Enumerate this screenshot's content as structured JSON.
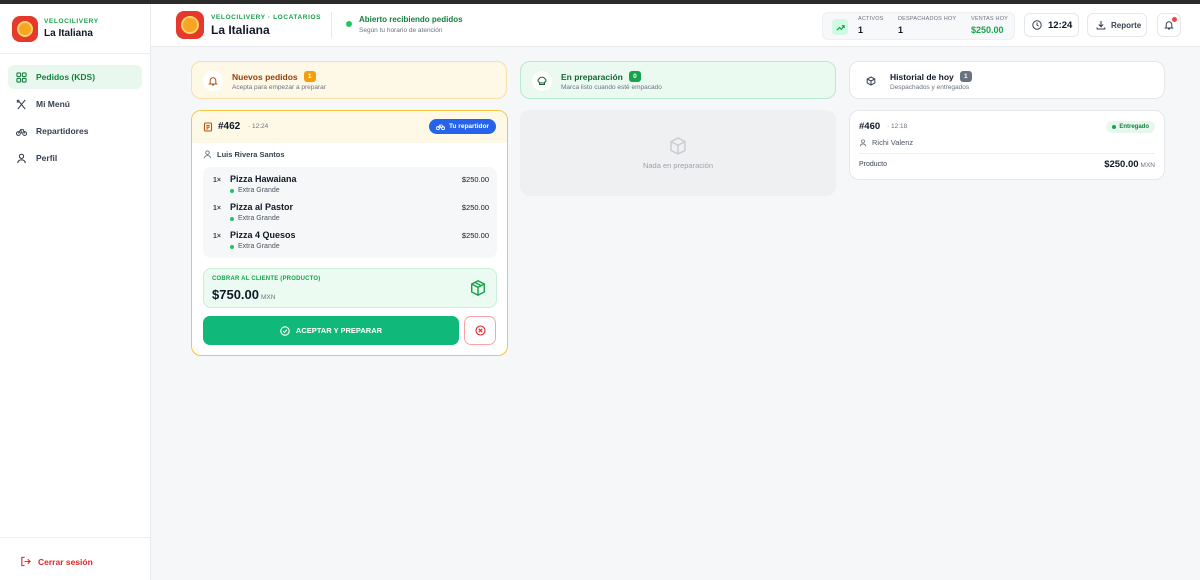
{
  "brand": {
    "kicker": "VELOCILIVERY",
    "name": "La Italiana"
  },
  "nav": {
    "items": [
      {
        "label": "Pedidos (KDS)",
        "icon": "grid-icon",
        "active": true
      },
      {
        "label": "Mi Menú",
        "icon": "utensils-icon",
        "active": false
      },
      {
        "label": "Repartidores",
        "icon": "bike-icon",
        "active": false
      },
      {
        "label": "Perfil",
        "icon": "user-icon",
        "active": false
      }
    ],
    "logout": "Cerrar sesión"
  },
  "header": {
    "kicker": "VELOCILIVERY · LOCATARIOS",
    "name": "La Italiana",
    "status": "Abierto recibiendo pedidos",
    "status_sub": "Según tu horario de atención",
    "stats": {
      "activos_label": "ACTIVOS",
      "activos": "1",
      "despachados_label": "DESPACHADOS HOY",
      "despachados": "1",
      "ventas_label": "VENTAS HOY",
      "ventas": "$250.00"
    },
    "time": "12:24",
    "report": "Reporte"
  },
  "columns": {
    "new": {
      "title": "Nuevos pedidos",
      "count": "1",
      "sub": "Acepta para empezar a preparar"
    },
    "prep": {
      "title": "En preparación",
      "count": "0",
      "sub": "Marca listo cuando esté empacado",
      "empty": "Nada en preparación"
    },
    "history": {
      "title": "Historial de hoy",
      "count": "1",
      "sub": "Despachados y entregados"
    }
  },
  "order": {
    "number": "#462",
    "time": "· 12:24",
    "rider_pill": "Tu repartidor",
    "customer": "Luis Rivera Santos",
    "items": [
      {
        "qty": "1×",
        "name": "Pizza Hawaiana",
        "variant": "Extra Grande",
        "price": "$250.00"
      },
      {
        "qty": "1×",
        "name": "Pizza al Pastor",
        "variant": "Extra Grande",
        "price": "$250.00"
      },
      {
        "qty": "1×",
        "name": "Pizza 4 Quesos",
        "variant": "Extra Grande",
        "price": "$250.00"
      }
    ],
    "charge_label": "COBRAR AL CLIENTE (PRODUCTO)",
    "charge_amount": "$750.00",
    "charge_currency": "MXN",
    "accept": "ACEPTAR Y PREPARAR"
  },
  "history_card": {
    "number": "#460",
    "time": "· 12:18",
    "badge": "Entregado",
    "rider": "Richi Valenz",
    "product_label": "Producto",
    "amount": "$250.00",
    "currency": "MXN"
  },
  "colors": {
    "accent": "#10b97a",
    "brand_red": "#e53a2b",
    "warning": "#f4c542",
    "danger": "#dc2626",
    "rider_blue": "#2563eb"
  }
}
